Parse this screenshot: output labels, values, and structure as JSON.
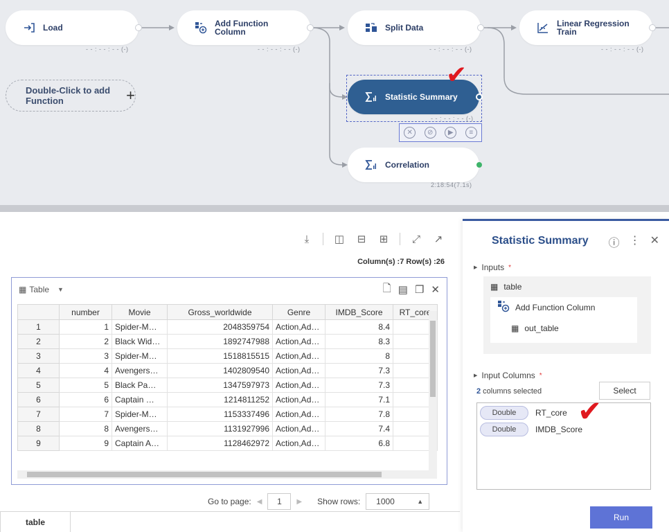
{
  "canvas": {
    "nodes": [
      {
        "id": "load",
        "label": "Load",
        "status": "- - : - - : - - (-)"
      },
      {
        "id": "add-function-column",
        "label": "Add Function\nColumn",
        "status": "- - : - - : - - (-)"
      },
      {
        "id": "split-data",
        "label": "Split Data",
        "status": "- - : - - : - - (-)"
      },
      {
        "id": "linear-regression-train",
        "label": "Linear Regression\nTrain",
        "status": "- - : - - : - - (-)"
      },
      {
        "id": "statistic-summary",
        "label": "Statistic Summary",
        "status": "- - : - - : - - (-)"
      },
      {
        "id": "correlation",
        "label": "Correlation",
        "status": "2:18:54(7.1s)"
      }
    ],
    "add_function": {
      "label": "Double-Click\nto add Function",
      "plus": "+"
    },
    "colors": {
      "selected_node": "#2f5f92",
      "checkmark": "#e0191f",
      "run_button": "#5e73d6"
    }
  },
  "data_panel": {
    "toolbar_icons": [
      "download-icon",
      "split-columns-icon",
      "split-rows-icon",
      "grid-icon",
      "expand-icon",
      "popout-icon"
    ],
    "counts": "Column(s) :7   Row(s) :26",
    "table_title": "Table",
    "columns": [
      "",
      "number",
      "Movie",
      "Gross_worldwide",
      "Genre",
      "IMDB_Score",
      "RT_core"
    ],
    "rows": [
      [
        "1",
        "1",
        "Spider-M…",
        "2048359754",
        "Action,Ad…",
        "8.4",
        ""
      ],
      [
        "2",
        "2",
        "Black Wid…",
        "1892747988",
        "Action,Ad…",
        "8.3",
        ""
      ],
      [
        "3",
        "3",
        "Spider-M…",
        "1518815515",
        "Action,Ad…",
        "8",
        ""
      ],
      [
        "4",
        "4",
        "Avengers…",
        "1402809540",
        "Action,Ad…",
        "7.3",
        ""
      ],
      [
        "5",
        "5",
        "Black Pa…",
        "1347597973",
        "Action,Ad…",
        "7.3",
        ""
      ],
      [
        "6",
        "6",
        "Captain …",
        "1214811252",
        "Action,Ad…",
        "7.1",
        ""
      ],
      [
        "7",
        "7",
        "Spider-M…",
        "1153337496",
        "Action,Ad…",
        "7.8",
        ""
      ],
      [
        "8",
        "8",
        "Avengers…",
        "1131927996",
        "Action,Ad…",
        "7.4",
        ""
      ],
      [
        "9",
        "9",
        "Captain A…",
        "1128462972",
        "Action,Ad…",
        "6.8",
        ""
      ]
    ],
    "pager": {
      "goto_label": "Go to page:",
      "page": "1",
      "show_rows_label": "Show rows:",
      "rows": "1000"
    },
    "bottom_tab": "table"
  },
  "properties": {
    "title": "Statistic Summary",
    "inputs_label": "Inputs",
    "input_table": "table",
    "input_source": "Add Function Column",
    "input_out": "out_table",
    "input_columns_label": "Input Columns",
    "columns_selected_count": "2",
    "columns_selected_text": " columns selected",
    "select_button": "Select",
    "selected_columns": [
      {
        "type": "Double",
        "name": "RT_core"
      },
      {
        "type": "Double",
        "name": "IMDB_Score"
      }
    ],
    "run_button": "Run"
  }
}
